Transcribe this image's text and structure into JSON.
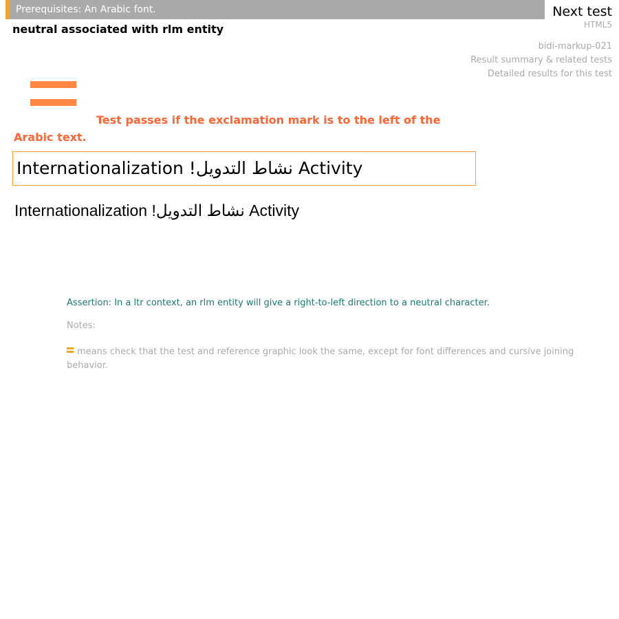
{
  "header": {
    "prerequisites": "Prerequisites: An Arabic font.",
    "next_test": "Next test",
    "format": "HTML5",
    "test_id": "bidi-markup-021",
    "result_summary_link": "Result summary & related tests",
    "detailed_results_link": "Detailed results for this test"
  },
  "title": "neutral associated with rlm entity",
  "instructions": "Test passes if the exclamation mark is to the left of the Arabic text.",
  "test_text": "Internationalization !نشاط التدويل Activity",
  "reference_text": "Internationalization !نشاط التدويل Activity",
  "assertion": "Assertion: In a ltr context, an rlm entity will give a right-to-left direction to a neutral character.",
  "notes": {
    "label": "Notes:",
    "equals_note": "means check that the test and reference graphic look the same, except for font differences and cursive joining behavior."
  },
  "colors": {
    "prereq_bar": "#aaaaaa",
    "accent_orange": "#f5a623",
    "instruction_text": "#ff6633",
    "equals_icon": "#ff8844",
    "assertion_text": "#1a7a6e",
    "muted_text": "#aaaaaa"
  },
  "icons": {
    "large_equals": "equals-icon",
    "small_equals": "equals-icon"
  }
}
